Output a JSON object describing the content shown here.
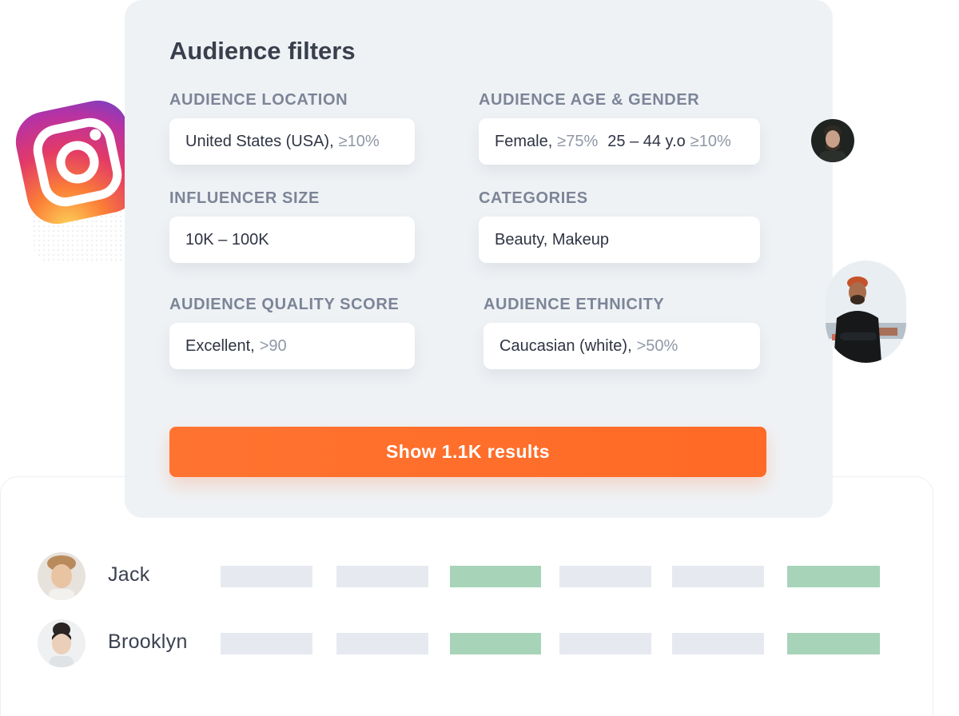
{
  "panel": {
    "title": "Audience filters",
    "filters": {
      "location": {
        "label": "AUDIENCE LOCATION",
        "value": "United States (USA),",
        "threshold": "≥10%"
      },
      "age_gender": {
        "label": "AUDIENCE AGE & GENDER",
        "gender": "Female,",
        "gender_threshold": "≥75%",
        "age": "25 – 44 y.o",
        "age_threshold": "≥10%"
      },
      "size": {
        "label": "INFLUENCER SIZE",
        "value": "10K – 100K"
      },
      "categories": {
        "label": "CATEGORIES",
        "value": "Beauty, Makeup"
      },
      "quality": {
        "label": "AUDIENCE QUALITY SCORE",
        "value": "Excellent,",
        "threshold": ">90"
      },
      "ethnicity": {
        "label": "AUDIENCE ETHNICITY",
        "value": "Caucasian (white),",
        "threshold": ">50%"
      }
    },
    "cta_label": "Show 1.1K results",
    "accent_color": "#ff6b2b"
  },
  "results": [
    {
      "name": "Jack",
      "bars": [
        "grey",
        "grey",
        "green",
        "grey",
        "grey",
        "green"
      ]
    },
    {
      "name": "Brooklyn",
      "bars": [
        "grey",
        "grey",
        "green",
        "grey",
        "grey",
        "green"
      ]
    }
  ],
  "icons": {
    "platform": "instagram-logo-icon"
  },
  "colors": {
    "bar_grey": "#e6e9ef",
    "bar_green": "#a7d4b9",
    "panel_bg": "#eff2f5"
  }
}
